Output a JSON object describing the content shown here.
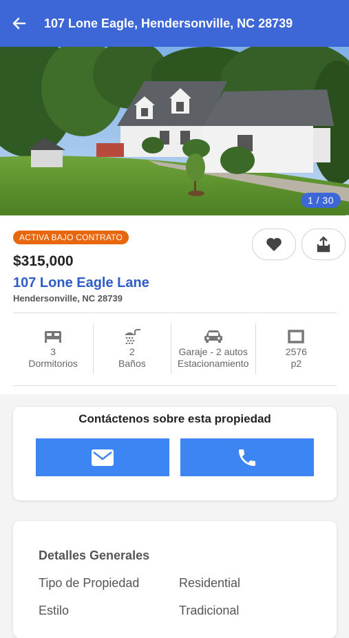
{
  "header": {
    "title": "107 Lone Eagle, Hendersonville, NC 28739",
    "back_icon": "arrow-left-icon"
  },
  "photo": {
    "counter": "1 / 30"
  },
  "listing": {
    "status": "ACTIVA BAJO CONTRATO",
    "price": "$315,000",
    "street": "107 Lone Eagle Lane",
    "city": "Hendersonville, NC 28739",
    "favorite_icon": "heart-icon",
    "share_icon": "share-icon"
  },
  "features": [
    {
      "icon": "bed-icon",
      "value": "3",
      "label": "Dormitorios"
    },
    {
      "icon": "shower-icon",
      "value": "2",
      "label": "Baños"
    },
    {
      "icon": "car-icon",
      "value": "Garaje - 2 autos",
      "label": "Estacionamiento"
    },
    {
      "icon": "square-icon",
      "value": "2576",
      "label": "p2"
    }
  ],
  "contact": {
    "title": "Contáctenos sobre esta propiedad",
    "email_icon": "envelope-icon",
    "phone_icon": "phone-icon"
  },
  "details": {
    "title": "Detalles Generales",
    "rows": [
      {
        "label": "Tipo de Propiedad",
        "value": "Residential"
      },
      {
        "label": "Estilo",
        "value": "Tradicional"
      }
    ]
  },
  "colors": {
    "header_bg": "#3d66d6",
    "status_badge": "#e8660c",
    "link_blue": "#2d5bc7",
    "button_blue": "#3c85f3"
  }
}
